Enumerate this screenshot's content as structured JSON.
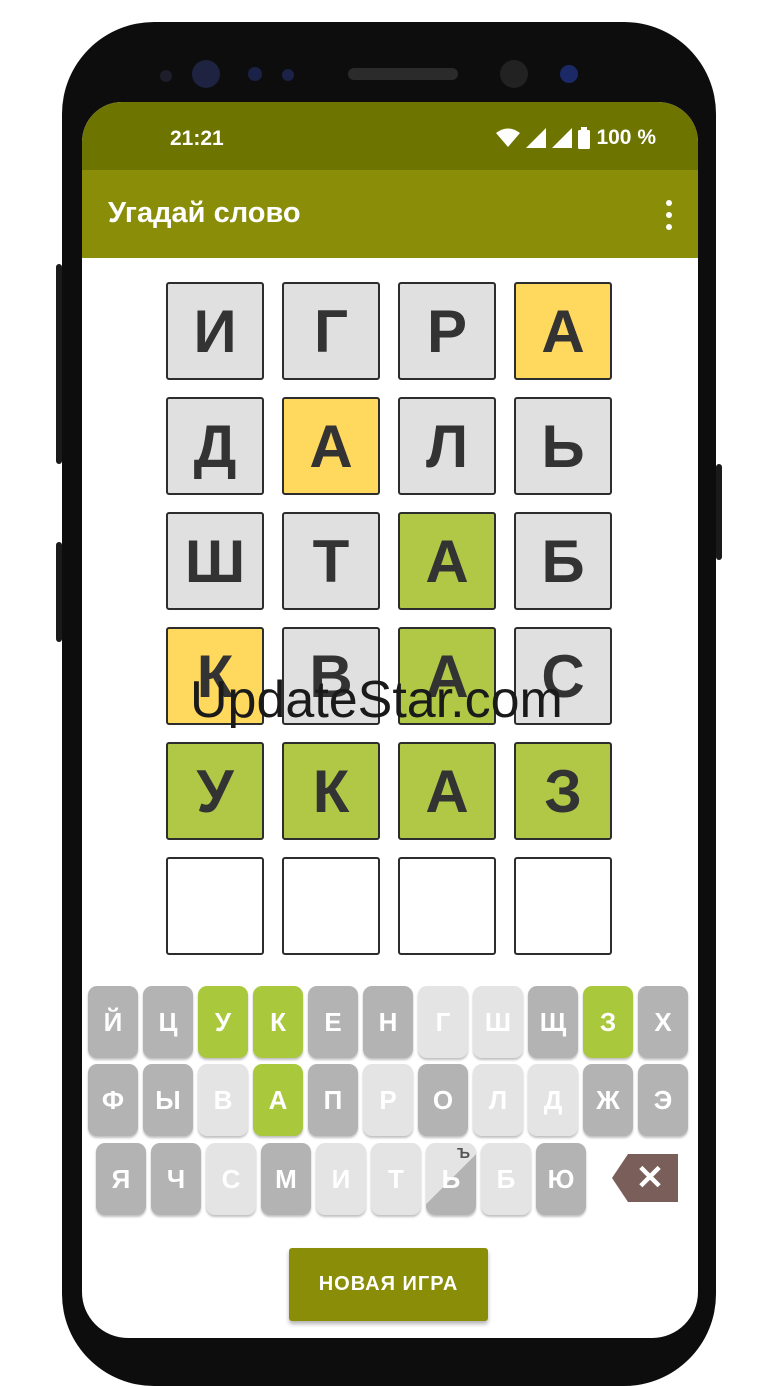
{
  "status_bar": {
    "time": "21:21",
    "battery": "100 %"
  },
  "app_bar": {
    "title": "Угадай слово"
  },
  "grid": [
    [
      {
        "letter": "И",
        "state": "gray"
      },
      {
        "letter": "Г",
        "state": "gray"
      },
      {
        "letter": "Р",
        "state": "gray"
      },
      {
        "letter": "А",
        "state": "yellow"
      }
    ],
    [
      {
        "letter": "Д",
        "state": "gray"
      },
      {
        "letter": "А",
        "state": "yellow"
      },
      {
        "letter": "Л",
        "state": "gray"
      },
      {
        "letter": "Ь",
        "state": "gray"
      }
    ],
    [
      {
        "letter": "Ш",
        "state": "gray"
      },
      {
        "letter": "Т",
        "state": "gray"
      },
      {
        "letter": "А",
        "state": "green"
      },
      {
        "letter": "Б",
        "state": "gray"
      }
    ],
    [
      {
        "letter": "К",
        "state": "yellow"
      },
      {
        "letter": "В",
        "state": "gray"
      },
      {
        "letter": "А",
        "state": "green"
      },
      {
        "letter": "С",
        "state": "gray"
      }
    ],
    [
      {
        "letter": "У",
        "state": "green"
      },
      {
        "letter": "К",
        "state": "green"
      },
      {
        "letter": "А",
        "state": "green"
      },
      {
        "letter": "З",
        "state": "green"
      }
    ],
    [
      {
        "letter": "",
        "state": "empty"
      },
      {
        "letter": "",
        "state": "empty"
      },
      {
        "letter": "",
        "state": "empty"
      },
      {
        "letter": "",
        "state": "empty"
      }
    ]
  ],
  "keyboard": {
    "rows": [
      [
        {
          "label": "Й",
          "state": "gray"
        },
        {
          "label": "Ц",
          "state": "gray"
        },
        {
          "label": "У",
          "state": "green"
        },
        {
          "label": "К",
          "state": "green"
        },
        {
          "label": "Е",
          "state": "gray"
        },
        {
          "label": "Н",
          "state": "gray"
        },
        {
          "label": "Г",
          "state": "light"
        },
        {
          "label": "Ш",
          "state": "light"
        },
        {
          "label": "Щ",
          "state": "gray"
        },
        {
          "label": "З",
          "state": "green"
        },
        {
          "label": "Х",
          "state": "gray"
        }
      ],
      [
        {
          "label": "Ф",
          "state": "gray"
        },
        {
          "label": "Ы",
          "state": "gray"
        },
        {
          "label": "В",
          "state": "light"
        },
        {
          "label": "А",
          "state": "green"
        },
        {
          "label": "П",
          "state": "gray"
        },
        {
          "label": "Р",
          "state": "light"
        },
        {
          "label": "О",
          "state": "gray"
        },
        {
          "label": "Л",
          "state": "light"
        },
        {
          "label": "Д",
          "state": "light"
        },
        {
          "label": "Ж",
          "state": "gray"
        },
        {
          "label": "Э",
          "state": "gray"
        }
      ],
      [
        {
          "label": "Я",
          "state": "gray"
        },
        {
          "label": "Ч",
          "state": "gray"
        },
        {
          "label": "С",
          "state": "light"
        },
        {
          "label": "М",
          "state": "gray"
        },
        {
          "label": "И",
          "state": "light"
        },
        {
          "label": "Т",
          "state": "light"
        },
        {
          "label": "Ь",
          "state": "split",
          "sub": "Ъ"
        },
        {
          "label": "Б",
          "state": "light"
        },
        {
          "label": "Ю",
          "state": "gray"
        }
      ]
    ],
    "backspace_symbol": "✕"
  },
  "new_game_label": "НОВАЯ ИГРА",
  "watermark": "UpdateStar.com",
  "colors": {
    "status_bar": "#6d7400",
    "app_bar": "#8a8d08",
    "tile_green": "#b1c847",
    "tile_yellow": "#ffd95e",
    "tile_gray": "#e0e0e0",
    "key_green": "#a9c83c",
    "key_gray": "#b3b3b3",
    "key_light": "#e4e4e4",
    "backspace": "#7a5e59"
  },
  "icons": [
    "wifi-icon",
    "signal-icon",
    "battery-icon",
    "overflow-menu-icon",
    "backspace-icon"
  ]
}
